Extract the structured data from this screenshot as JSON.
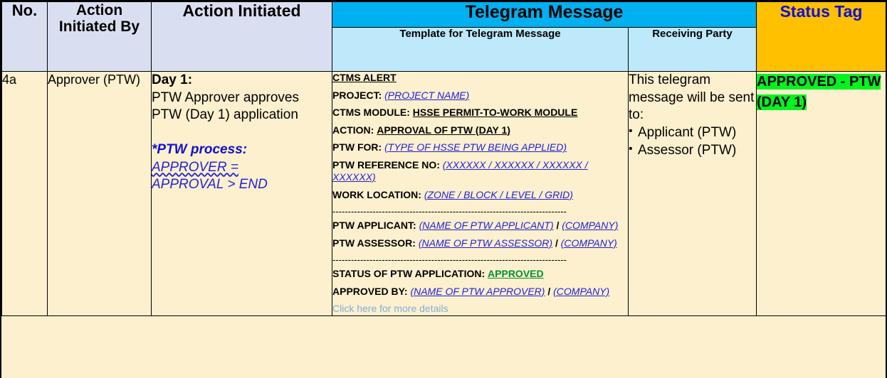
{
  "table": {
    "headers": {
      "no": "No.",
      "action_initiated_by": "Action Initiated By",
      "action_initiated": "Action Initiated",
      "telegram_message": "Telegram Message",
      "template_for_telegram_message": "Template for Telegram Message",
      "receiving_party": "Receiving Party",
      "status_tag": "Status Tag"
    },
    "row": {
      "no": "4a",
      "action_initiated_by": "Approver (PTW)",
      "action_initiated": {
        "day_label": "Day 1:",
        "description": "PTW Approver approves PTW (Day 1) application",
        "process_note_title": "*PTW process:",
        "process_flow_part1": "APPROVER  =",
        "process_flow_part2": "APPROVAL > END"
      },
      "telegram_template": {
        "alert_title": "CTMS ALERT",
        "project_label": "PROJECT:",
        "project_value": "(PROJECT NAME)",
        "module_label": "CTMS MODULE:",
        "module_value": "HSSE PERMIT-TO-WORK MODULE",
        "action_label": "ACTION:",
        "action_value": "APPROVAL OF PTW (DAY 1)",
        "ptw_for_label": "PTW FOR:",
        "ptw_for_value": "(TYPE OF HSSE PTW BEING APPLIED)",
        "ptw_ref_label": "PTW REFERENCE NO:",
        "ptw_ref_value": "(XXXXXX / XXXXXX / XXXXXX / XXXXXX)",
        "work_location_label": "WORK LOCATION:",
        "work_location_value": "(ZONE / BLOCK / LEVEL / GRID)",
        "divider_1": "----------------------------------------------------------------------------",
        "applicant_label": "PTW APPLICANT:",
        "applicant_value": "(NAME OF PTW APPLICANT)",
        "applicant_separator": " / ",
        "applicant_company": "(COMPANY)",
        "assessor_label": "PTW ASSESSOR:",
        "assessor_value": "(NAME OF PTW ASSESSOR)",
        "assessor_separator": " / ",
        "assessor_company": "(COMPANY)",
        "divider_2": "----------------------------------------------------------------------------",
        "status_label": "STATUS OF PTW APPLICATION:",
        "status_value": "APPROVED",
        "approved_by_label": "APPROVED BY:",
        "approved_by_value": "(NAME OF PTW APPROVER)",
        "approved_by_separator": " / ",
        "approved_by_company": "(COMPANY)",
        "more_details_link": "Click here for more details"
      },
      "receiving_party": {
        "intro": "This telegram message will be sent to:",
        "recipients": [
          "Applicant (PTW)",
          "Assessor (PTW)"
        ]
      },
      "status_tag": "APPROVED - PTW (DAY 1)"
    }
  },
  "colors": {
    "header_plain_bg": "#D9DEF0",
    "telegram_header_bg": "#00B0F0",
    "telegram_subheader_bg": "#BDE9FB",
    "status_header_bg": "#FFC000",
    "status_header_text": "#1010CF",
    "body_bg": "#FDF0CE",
    "placeholder_blue": "#2020DD",
    "approved_green": "#00912F",
    "status_tag_highlight": "#00F51E",
    "link_blue": "#7EAEDC"
  }
}
